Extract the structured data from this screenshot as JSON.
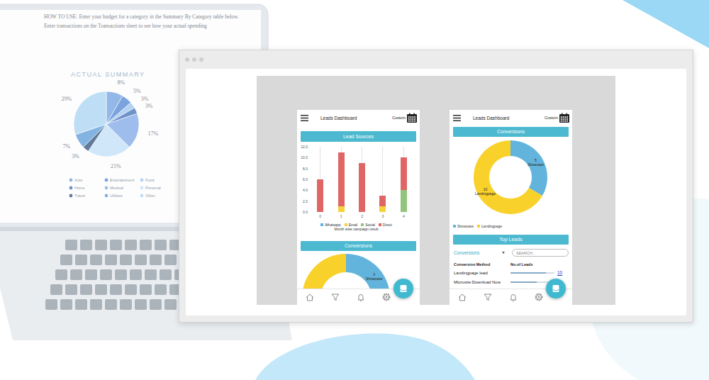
{
  "laptop": {
    "instructions": [
      "HOW TO USE: Enter your budget for a category in the Summary By Category table below.",
      "Enter transactions on the Transactions sheet to see how your actual spending"
    ],
    "chart_title": "ACTUAL SUMMARY",
    "slices": [
      {
        "label": "8%",
        "value": 8,
        "color": "#6f9fe0"
      },
      {
        "label": "5%",
        "value": 5,
        "color": "#4f86d4"
      },
      {
        "label": "3%",
        "value": 3,
        "color": "#9cc3ee"
      },
      {
        "label": "3%",
        "value": 3,
        "color": "#3f6fb8"
      },
      {
        "label": "17%",
        "value": 17,
        "color": "#7fa8e6"
      },
      {
        "label": "21%",
        "value": 21,
        "color": "#bfe0f7"
      },
      {
        "label": "3%",
        "value": 3,
        "color": "#2f4f7a"
      },
      {
        "label": "7%",
        "value": 7,
        "color": "#5a9bd8"
      },
      {
        "label": "29%",
        "value": 29,
        "color": "#a9d3f2"
      }
    ],
    "legend": [
      {
        "label": "Auto",
        "color": "#6f9fe0"
      },
      {
        "label": "Entertainment",
        "color": "#4f86d4"
      },
      {
        "label": "Food",
        "color": "#9cc3ee"
      },
      {
        "label": "Home",
        "color": "#3f6fb8"
      },
      {
        "label": "Medical",
        "color": "#7fa8e6"
      },
      {
        "label": "Personal",
        "color": "#bfe0f7"
      },
      {
        "label": "Travel",
        "color": "#2f4f7a"
      },
      {
        "label": "Utilities",
        "color": "#5a9bd8"
      },
      {
        "label": "Other",
        "color": "#a9d3f2"
      }
    ]
  },
  "left_screen": {
    "title": "Leads Dashboard",
    "range": "Custom",
    "lead_sources": {
      "heading": "Lead Sources",
      "y_ticks": [
        "12.0",
        "10.0",
        "8.0",
        "6.0",
        "4.0",
        "2.0",
        "0.0"
      ],
      "categories": [
        "0",
        "1",
        "2",
        "3",
        "4"
      ],
      "series": [
        {
          "name": "Whatsapp",
          "color": "#5db4de",
          "values": [
            0,
            0,
            0,
            0,
            0
          ]
        },
        {
          "name": "Email",
          "color": "#f6d23a",
          "values": [
            0,
            1,
            0,
            1,
            0
          ]
        },
        {
          "name": "Social",
          "color": "#93c47d",
          "values": [
            0,
            0,
            0,
            0,
            4
          ]
        },
        {
          "name": "Direct",
          "color": "#e06666",
          "values": [
            6,
            10,
            9,
            2,
            6
          ]
        }
      ],
      "caption": "Month wise campaign result"
    },
    "conversions": {
      "heading": "Conversions",
      "segments": [
        {
          "value": 3,
          "color": "#62b4dc",
          "caption": [
            "3",
            "Showcase"
          ]
        },
        {
          "value": 7,
          "color": "#f9d12b"
        }
      ]
    }
  },
  "right_screen": {
    "title": "Leads Dashboard",
    "range": "Custom",
    "conversions": {
      "heading": "Conversions",
      "segments": [
        {
          "value": 5,
          "color": "#62b4dc",
          "caption": [
            "5",
            "Showcase"
          ]
        },
        {
          "value": 10,
          "color": "#f9d12b",
          "caption": [
            "10",
            "Landingpage"
          ]
        }
      ],
      "legend": [
        {
          "label": "Showcase",
          "color": "#62b4dc"
        },
        {
          "label": "Landingpage",
          "color": "#f9d12b"
        }
      ]
    },
    "top_leads": {
      "heading": "Top Leads",
      "filter": {
        "value": "Conversions"
      },
      "search": {
        "placeholder": "SEARCH.."
      },
      "columns": [
        "Conversion Method",
        "No.of Leads"
      ],
      "rows": [
        {
          "method": "Landingpage lead",
          "level": 0.8,
          "count": "10"
        },
        {
          "method": "Microsite:Download Now",
          "level": 0.6
        }
      ]
    }
  }
}
